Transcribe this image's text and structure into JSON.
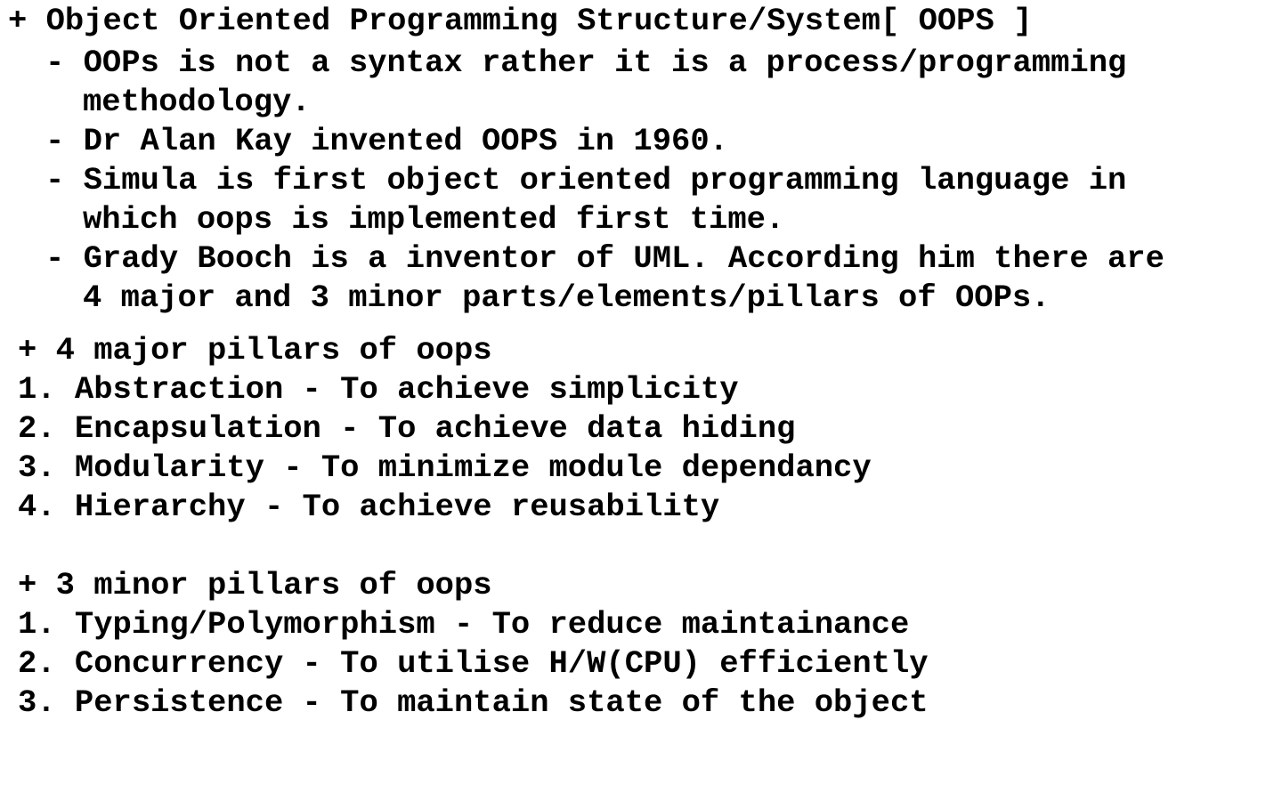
{
  "intro": {
    "heading": "+ Object Oriented Programming Structure/System[ OOPS ]",
    "bullets": [
      {
        "line1": "- OOPs is not a syntax rather it is a process/programming",
        "line2": "methodology."
      },
      {
        "line1": "- Dr Alan Kay invented OOPS in 1960."
      },
      {
        "line1": "- Simula is first object oriented programming language in",
        "line2": "which oops is implemented first time."
      },
      {
        "line1": "- Grady Booch is a inventor of UML. According him there are",
        "line2": "4 major and 3 minor parts/elements/pillars of OOPs."
      }
    ]
  },
  "major": {
    "heading": "+ 4 major pillars of oops",
    "items": [
      "1. Abstraction - To achieve simplicity",
      "2. Encapsulation - To achieve data hiding",
      "3. Modularity - To minimize module dependancy",
      "4. Hierarchy - To achieve reusability"
    ]
  },
  "minor": {
    "heading": "+ 3 minor pillars of oops",
    "items": [
      "1. Typing/Polymorphism - To reduce maintainance",
      "2. Concurrency - To utilise H/W(CPU) efficiently",
      "3. Persistence - To maintain state of the object"
    ]
  }
}
